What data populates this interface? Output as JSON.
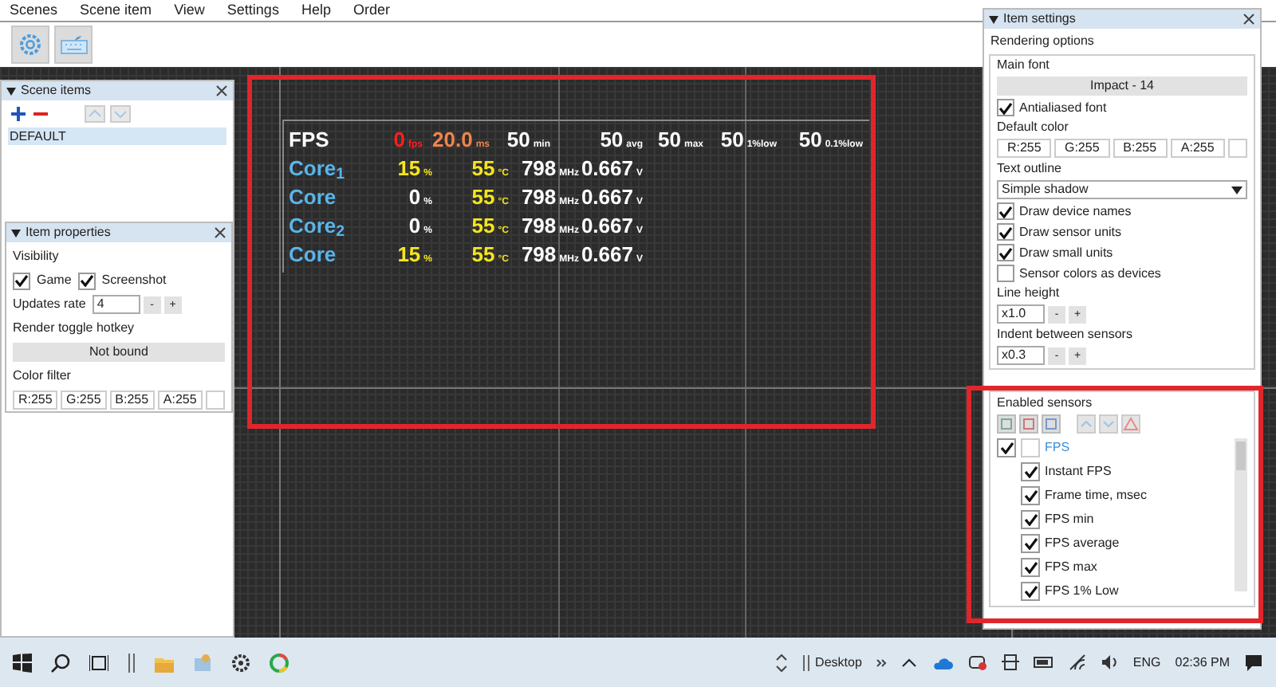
{
  "menu": [
    "Scenes",
    "Scene item",
    "View",
    "Settings",
    "Help",
    "Order"
  ],
  "scene_items": {
    "title": "Scene items",
    "items": [
      {
        "label": "DEFAULT",
        "selected": true
      }
    ]
  },
  "item_properties": {
    "title": "Item properties",
    "visibility_label": "Visibility",
    "checkboxes": [
      {
        "label": "Game",
        "checked": true
      },
      {
        "label": "Screenshot",
        "checked": true
      }
    ],
    "updates_rate": {
      "label": "Updates rate",
      "value": "4",
      "buttons": [
        "-",
        "+"
      ]
    },
    "hotkey_label": "Render toggle hotkey",
    "hotkey_button": "Not bound",
    "color_filter_label": "Color filter",
    "color_fields": [
      "R:255",
      "G:255",
      "B:255",
      "A:255"
    ]
  },
  "osd": {
    "rows": [
      {
        "label": "FPS",
        "cells": [
          {
            "value": "0",
            "unit": "fps",
            "color": "#ff1f1f"
          },
          {
            "value": "20.0",
            "unit": "ms",
            "color": "#f0844a"
          },
          {
            "value": "50",
            "unit": "min",
            "color": "#ffffff"
          },
          {
            "value": "50",
            "unit": "avg",
            "color": "#ffffff"
          },
          {
            "value": "50",
            "unit": "max",
            "color": "#ffffff"
          },
          {
            "value": "50",
            "unit": "1%low",
            "color": "#ffffff"
          },
          {
            "value": "50",
            "unit": "0.1%low",
            "color": "#ffffff"
          }
        ]
      },
      {
        "label": "Core$_{1}$",
        "cells": [
          {
            "value": "15",
            "unit": "%",
            "color": "#f5e61e"
          },
          {
            "value": "55",
            "unit": "°C",
            "color": "#f5e61e"
          },
          {
            "value": "798",
            "unit": "MHz",
            "color": "#ffffff"
          },
          {
            "value": "0.667",
            "unit": "V",
            "color": "#ffffff"
          }
        ]
      },
      {
        "label": "Core",
        "cells": [
          {
            "value": "0",
            "unit": "%",
            "color": "#ffffff"
          },
          {
            "value": "55",
            "unit": "°C",
            "color": "#f5e61e"
          },
          {
            "value": "798",
            "unit": "MHz",
            "color": "#ffffff"
          },
          {
            "value": "0.667",
            "unit": "V",
            "color": "#ffffff"
          }
        ]
      },
      {
        "label": "Core$_{2}$",
        "cells": [
          {
            "value": "0",
            "unit": "%",
            "color": "#ffffff"
          },
          {
            "value": "55",
            "unit": "°C",
            "color": "#f5e61e"
          },
          {
            "value": "798",
            "unit": "MHz",
            "color": "#ffffff"
          },
          {
            "value": "0.667",
            "unit": "V",
            "color": "#ffffff"
          }
        ]
      },
      {
        "label": "Core",
        "cells": [
          {
            "value": "15",
            "unit": "%",
            "color": "#f5e61e"
          },
          {
            "value": "55",
            "unit": "°C",
            "color": "#f5e61e"
          },
          {
            "value": "798",
            "unit": "MHz",
            "color": "#ffffff"
          },
          {
            "value": "0.667",
            "unit": "V",
            "color": "#ffffff"
          }
        ]
      }
    ]
  },
  "item_settings": {
    "title": "Item settings",
    "section": "Rendering options",
    "main_font_label": "Main font",
    "main_font_button": "Impact - 14",
    "antialiased": {
      "label": "Antialiased font",
      "checked": true
    },
    "default_color_label": "Default color",
    "color_fields": [
      "R:255",
      "G:255",
      "B:255",
      "A:255"
    ],
    "text_outline_label": "Text outline",
    "text_outline_value": "Simple shadow",
    "options": [
      {
        "label": "Draw device names",
        "checked": true
      },
      {
        "label": "Draw sensor units",
        "checked": true
      },
      {
        "label": "Draw small units",
        "checked": true
      },
      {
        "label": "Sensor colors as devices",
        "checked": false
      }
    ],
    "line_height": {
      "label": "Line height",
      "value": "x1.0",
      "buttons": [
        "-",
        "+"
      ]
    },
    "indent": {
      "label": "Indent between sensors",
      "value": "x0.3",
      "buttons": [
        "-",
        "+"
      ]
    }
  },
  "enabled_sensors": {
    "title": "Enabled sensors",
    "tree": [
      {
        "label": "FPS",
        "checked": true,
        "children": [
          {
            "label": "Instant FPS",
            "checked": true
          },
          {
            "label": "Frame time, msec",
            "checked": true
          },
          {
            "label": "FPS min",
            "checked": true
          },
          {
            "label": "FPS average",
            "checked": true
          },
          {
            "label": "FPS max",
            "checked": true
          },
          {
            "label": "FPS 1% Low",
            "checked": true
          }
        ]
      }
    ]
  },
  "taskbar": {
    "desktop_label": "Desktop",
    "language": "ENG",
    "time": "02:36 PM"
  }
}
